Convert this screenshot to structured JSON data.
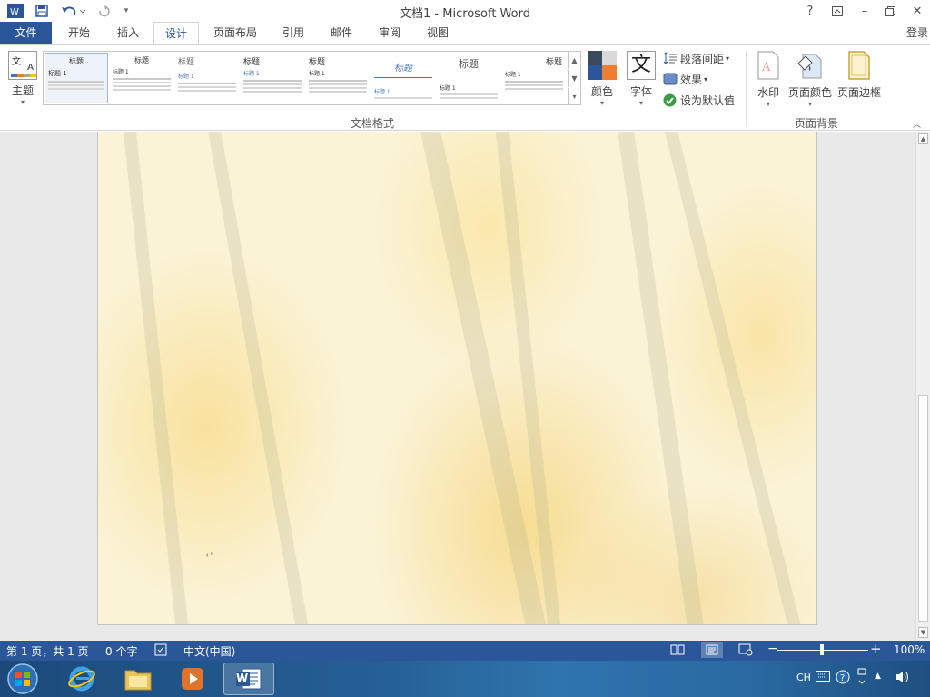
{
  "titlebar": {
    "title": "文档1 - Microsoft Word",
    "help": "?",
    "minimize": "–",
    "close": "✕"
  },
  "tabs": [
    {
      "label": "文件"
    },
    {
      "label": "开始"
    },
    {
      "label": "插入"
    },
    {
      "label": "设计"
    },
    {
      "label": "页面布局"
    },
    {
      "label": "引用"
    },
    {
      "label": "邮件"
    },
    {
      "label": "审阅"
    },
    {
      "label": "视图"
    }
  ],
  "login": "登录",
  "ribbon": {
    "theme_label": "主题",
    "gallery_items": [
      {
        "heading": "标题",
        "sub": "标题 1"
      },
      {
        "heading": "标题",
        "sub": "标题 1"
      },
      {
        "heading": "标题",
        "sub": "标题 1"
      },
      {
        "heading": "标题",
        "sub": "标题 1"
      },
      {
        "heading": "标题",
        "sub": "标题 1"
      },
      {
        "heading": "标题",
        "sub": "标题 1"
      },
      {
        "heading": "标题",
        "sub": "标题 1"
      },
      {
        "heading": "标题",
        "sub": "标题 1"
      }
    ],
    "colors_label": "颜色",
    "fonts_label": "字体",
    "fonts_glyph": "文",
    "paragraph_spacing": "段落间距",
    "effects": "效果",
    "set_default": "设为默认值",
    "group_document_format": "文档格式",
    "watermark": "水印",
    "page_color": "页面颜色",
    "page_borders": "页面边框",
    "group_page_background": "页面背景"
  },
  "document": {
    "paragraph_mark": "↵"
  },
  "status": {
    "page": "第 1 页，共 1 页",
    "words": "0 个字",
    "language": "中文(中国)",
    "zoom": "100%",
    "zoom_percent": 100
  },
  "taskbar": {
    "word_label": "W",
    "ime": "CH"
  },
  "colors": {
    "accent": "#2b579a",
    "taskbar": "#255f96"
  }
}
